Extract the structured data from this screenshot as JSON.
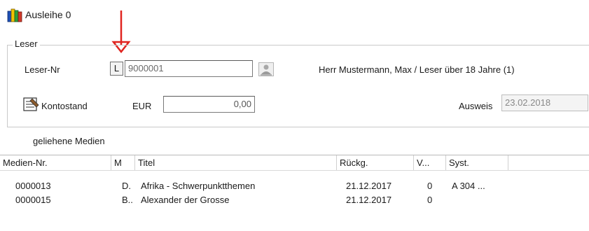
{
  "window": {
    "title": "Ausleihe 0"
  },
  "reader_group": {
    "legend": "Leser",
    "reader_no_label": "Leser-Nr",
    "lookup_button": "L",
    "reader_no_value": "9000001",
    "reader_info": "Herr Mustermann, Max / Leser über 18 Jahre (1)",
    "account_button": "Kontostand",
    "currency_label": "EUR",
    "account_value": "0,00",
    "id_card_label": "Ausweis",
    "id_card_value": "23.02.2018"
  },
  "loans_label": "geliehene Medien",
  "table": {
    "columns": [
      "Medien-Nr.",
      "M",
      "Titel",
      "Rückg.",
      "V...",
      "Syst.",
      ""
    ],
    "rows": [
      [
        "0000013",
        "D.",
        "Afrika - Schwerpunktthemen",
        "21.12.2017",
        "0",
        "A 304 ..."
      ],
      [
        "0000015",
        "B..",
        "Alexander der Grosse",
        "21.12.2017",
        "0",
        ""
      ]
    ]
  },
  "icons": {
    "title": "books-icon",
    "search": "person-search-icon",
    "account": "ledger-icon",
    "annotation": "red-arrow-icon"
  },
  "colors": {
    "annotation": "#e0241f"
  }
}
